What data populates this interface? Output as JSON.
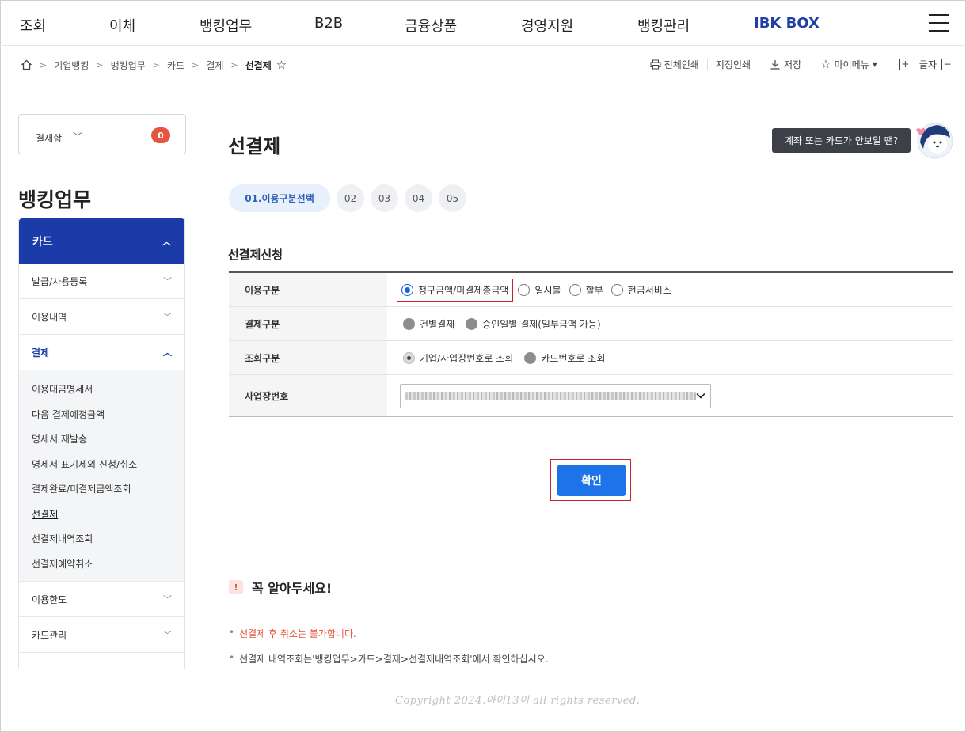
{
  "topnav": {
    "items": [
      "조회",
      "이체",
      "뱅킹업무",
      "B2B",
      "금융상품",
      "경영지원",
      "뱅킹관리",
      "IBK BOX"
    ],
    "accent_color": "#1f3fa6"
  },
  "breadcrumb": {
    "items": [
      "기업뱅킹",
      "뱅킹업무",
      "카드",
      "결제"
    ],
    "current": "선결제"
  },
  "tools": {
    "print_all": "전체인쇄",
    "print_selected": "지정인쇄",
    "save": "저장",
    "my_menu": "마이메뉴",
    "font_size": "글자"
  },
  "sidebar": {
    "cart_label": "결재함",
    "cart_count": "0",
    "title": "뱅킹업무",
    "section": "카드",
    "items": [
      {
        "label": "발급/사용등록"
      },
      {
        "label": "이용내역"
      },
      {
        "label": "결제"
      }
    ],
    "sub_items": [
      "이용대금명세서",
      "다음 결제예정금액",
      "명세서 재발송",
      "명세서 표기제외 신청/취소",
      "결제완료/미결제금액조회",
      "선결제",
      "선결제내역조회",
      "선결제예약취소"
    ],
    "after_items": [
      "이용한도",
      "카드관리"
    ],
    "brand_color": "#1b3ca8"
  },
  "main": {
    "title": "선결제",
    "help_text": "계좌 또는 카드가 안보일 땐?",
    "steps": [
      "01.이용구분선택",
      "02",
      "03",
      "04",
      "05"
    ],
    "section_title": "선결제신청",
    "rows": {
      "usage_label": "이용구분",
      "usage_options": [
        "청구금액/미결제총금액",
        "일시불",
        "할부",
        "현금서비스"
      ],
      "payment_label": "결제구분",
      "payment_options": [
        "건별결제",
        "승인일별 결제(일부금액 가능)"
      ],
      "inquiry_label": "조회구분",
      "inquiry_options": [
        "기업/사업장번호로 조회",
        "카드번호로 조회"
      ],
      "business_label": "사업장번호"
    },
    "confirm_label": "확인",
    "notice_title": "꼭 알아두세요!",
    "notices": [
      "선결제 후 취소는 불가합니다.",
      "선결제 내역조회는'뱅킹업무>카드>결제>선결제내역조회'에서 확인하십시오."
    ]
  },
  "copyright": "Copyright 2024.아이13이 all rights reserved."
}
